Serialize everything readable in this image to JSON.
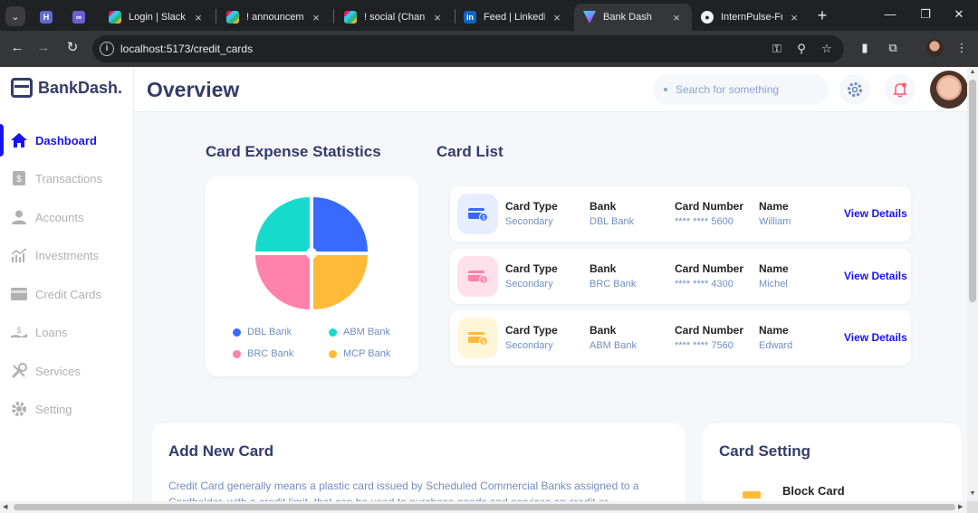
{
  "browser": {
    "tabs": [
      {
        "title": "",
        "icon": "linear-app-icon"
      },
      {
        "title": "",
        "icon": "github-copilot-icon"
      },
      {
        "title": "Login | Slack",
        "icon": "slack-icon"
      },
      {
        "title": "! announcemen",
        "icon": "slack-icon"
      },
      {
        "title": "! social (Channe",
        "icon": "slack-icon"
      },
      {
        "title": "Feed | LinkedIn",
        "icon": "linkedin-icon"
      },
      {
        "title": "Bank Dash",
        "icon": "vite-icon"
      },
      {
        "title": "InternPulse-Fro",
        "icon": "github-icon"
      }
    ],
    "url": "localhost:5173/credit_cards"
  },
  "brand": {
    "name": "BankDash."
  },
  "sidebar": {
    "items": [
      {
        "label": "Dashboard",
        "icon": "home-icon"
      },
      {
        "label": "Transactions",
        "icon": "transfer-icon"
      },
      {
        "label": "Accounts",
        "icon": "user-icon"
      },
      {
        "label": "Investments",
        "icon": "chart-icon"
      },
      {
        "label": "Credit Cards",
        "icon": "credit-card-icon"
      },
      {
        "label": "Loans",
        "icon": "loan-icon"
      },
      {
        "label": "Services",
        "icon": "service-icon"
      },
      {
        "label": "Setting",
        "icon": "gear-icon"
      }
    ]
  },
  "header": {
    "title": "Overview",
    "search_placeholder": "Search for something"
  },
  "stats": {
    "title": "Card Expense Statistics",
    "legend": [
      {
        "name": "DBL Bank",
        "color": "#396aff"
      },
      {
        "name": "ABM Bank",
        "color": "#16dbcc"
      },
      {
        "name": "BRC Bank",
        "color": "#ff82ac"
      },
      {
        "name": "MCP Bank",
        "color": "#ffbb38"
      }
    ]
  },
  "card_list": {
    "title": "Card List",
    "headers": {
      "type": "Card Type",
      "bank": "Bank",
      "number": "Card Number",
      "name": "Name"
    },
    "view_label": "View Details",
    "rows": [
      {
        "type": "Secondary",
        "bank": "DBL Bank",
        "number": "**** **** 5600",
        "name": "William",
        "tint": "#e7edff",
        "color": "#396aff"
      },
      {
        "type": "Secondary",
        "bank": "BRC Bank",
        "number": "**** **** 4300",
        "name": "Michel",
        "tint": "#ffe0eb",
        "color": "#ff82ac"
      },
      {
        "type": "Secondary",
        "bank": "ABM Bank",
        "number": "**** **** 7560",
        "name": "Edward",
        "tint": "#fff5d9",
        "color": "#ffbb38"
      }
    ]
  },
  "add_card": {
    "title": "Add New Card",
    "description": "Credit Card generally means a plastic card issued by Scheduled Commercial Banks assigned to a Cardholder, with a credit limit, that can be used to purchase goods and services on credit or"
  },
  "card_setting": {
    "title": "Card Setting",
    "first_item": "Block Card"
  }
}
